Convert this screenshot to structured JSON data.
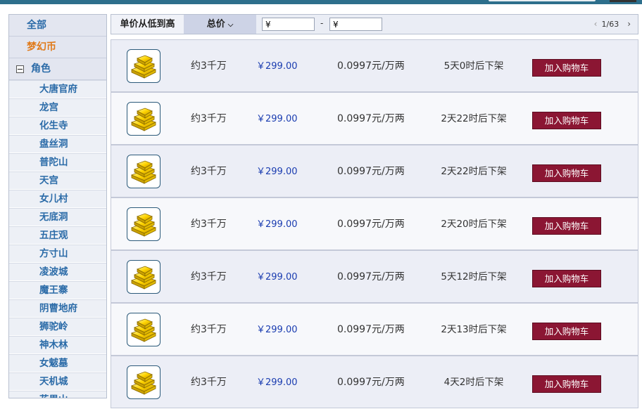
{
  "sidebar": {
    "all": "全部",
    "currency": "梦幻币",
    "group_label": "角色",
    "items": [
      "大唐官府",
      "龙宫",
      "化生寺",
      "盘丝洞",
      "普陀山",
      "天宫",
      "女儿村",
      "无底洞",
      "五庄观",
      "方寸山",
      "凌波城",
      "魔王寨",
      "阴曹地府",
      "狮驼岭",
      "神木林",
      "女魃墓",
      "天机城",
      "花果山"
    ]
  },
  "filter": {
    "sort_label": "单价从低到高",
    "total_label": "总价",
    "min_price": "¥",
    "max_price": "¥",
    "dash": "-",
    "page": "1/63"
  },
  "listings": [
    {
      "quantity": "约3千万",
      "price": "￥299.00",
      "unit_price": "0.0997元/万两",
      "time_left": "5天0时后下架",
      "button": "加入购物车"
    },
    {
      "quantity": "约3千万",
      "price": "￥299.00",
      "unit_price": "0.0997元/万两",
      "time_left": "2天22时后下架",
      "button": "加入购物车"
    },
    {
      "quantity": "约3千万",
      "price": "￥299.00",
      "unit_price": "0.0997元/万两",
      "time_left": "2天22时后下架",
      "button": "加入购物车"
    },
    {
      "quantity": "约3千万",
      "price": "￥299.00",
      "unit_price": "0.0997元/万两",
      "time_left": "2天20时后下架",
      "button": "加入购物车"
    },
    {
      "quantity": "约3千万",
      "price": "￥299.00",
      "unit_price": "0.0997元/万两",
      "time_left": "5天12时后下架",
      "button": "加入购物车"
    },
    {
      "quantity": "约3千万",
      "price": "￥299.00",
      "unit_price": "0.0997元/万两",
      "time_left": "2天13时后下架",
      "button": "加入购物车"
    },
    {
      "quantity": "约3千万",
      "price": "￥299.00",
      "unit_price": "0.0997元/万两",
      "time_left": "4天2时后下架",
      "button": "加入购物车"
    }
  ],
  "colors": {
    "accent": "#2d6f8c",
    "cart_button": "#8b1633",
    "price_text": "#1a3cb0",
    "currency_label": "#e07a1a"
  },
  "icons": {
    "item": "gold-bars-icon",
    "collapse": "minus-icon",
    "sort": "chevron-down-icon",
    "prev": "chevron-left-icon",
    "next": "chevron-right-icon"
  }
}
